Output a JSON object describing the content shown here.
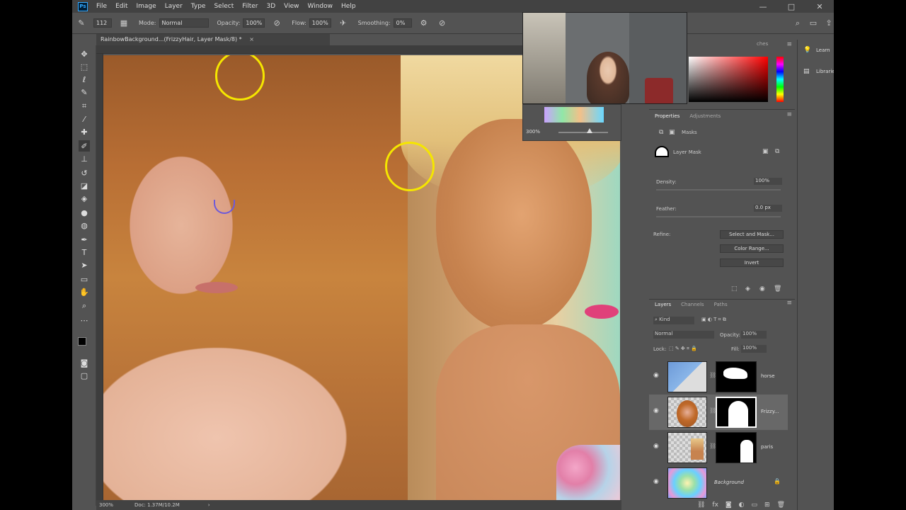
{
  "app": {
    "logo": "Ps"
  },
  "menu": [
    "File",
    "Edit",
    "Image",
    "Layer",
    "Type",
    "Select",
    "Filter",
    "3D",
    "View",
    "Window",
    "Help"
  ],
  "window_controls": [
    "—",
    "□",
    "✕"
  ],
  "options": {
    "mode_label": "Mode:",
    "mode_value": "Normal",
    "opacity_label": "Opacity:",
    "opacity_value": "100%",
    "flow_label": "Flow:",
    "flow_value": "100%",
    "smoothing_label": "Smoothing:",
    "smoothing_value": "0%",
    "brush_size": "112"
  },
  "document_tab": {
    "title": "RainbowBackground...(FrizzyHair, Layer Mask/8) *",
    "close": "×"
  },
  "status": {
    "zoom": "300%",
    "doc_info": "Doc: 1.37M/10.2M",
    "arrow": "›"
  },
  "navigator": {
    "zoom": "300%"
  },
  "color_panel": {
    "swatches_tab": "ches"
  },
  "side_panel": {
    "learn": "Learn",
    "libraries": "Libraries"
  },
  "properties": {
    "tabs": [
      "Properties",
      "Adjustments"
    ],
    "section": "Masks",
    "mask_type": "Layer Mask",
    "density_label": "Density:",
    "density_value": "100%",
    "feather_label": "Feather:",
    "feather_value": "0.0 px",
    "refine_label": "Refine:",
    "buttons": [
      "Select and Mask...",
      "Color Range...",
      "Invert"
    ]
  },
  "layers_panel": {
    "tabs": [
      "Layers",
      "Channels",
      "Paths"
    ],
    "filter": "Kind",
    "blend_mode": "Normal",
    "opacity_label": "Opacity:",
    "opacity_value": "100%",
    "lock_label": "Lock:",
    "fill_label": "Fill:",
    "fill_value": "100%",
    "layers": [
      {
        "name": "horse",
        "selected": false
      },
      {
        "name": "Frizzy...",
        "selected": true
      },
      {
        "name": "paris",
        "selected": false
      },
      {
        "name": "Background",
        "selected": false
      }
    ]
  },
  "colors": {
    "app_bg": "#535353",
    "menubar_bg": "#424242",
    "selection_circle": "#f5e600",
    "selected_layer": "#686868"
  }
}
